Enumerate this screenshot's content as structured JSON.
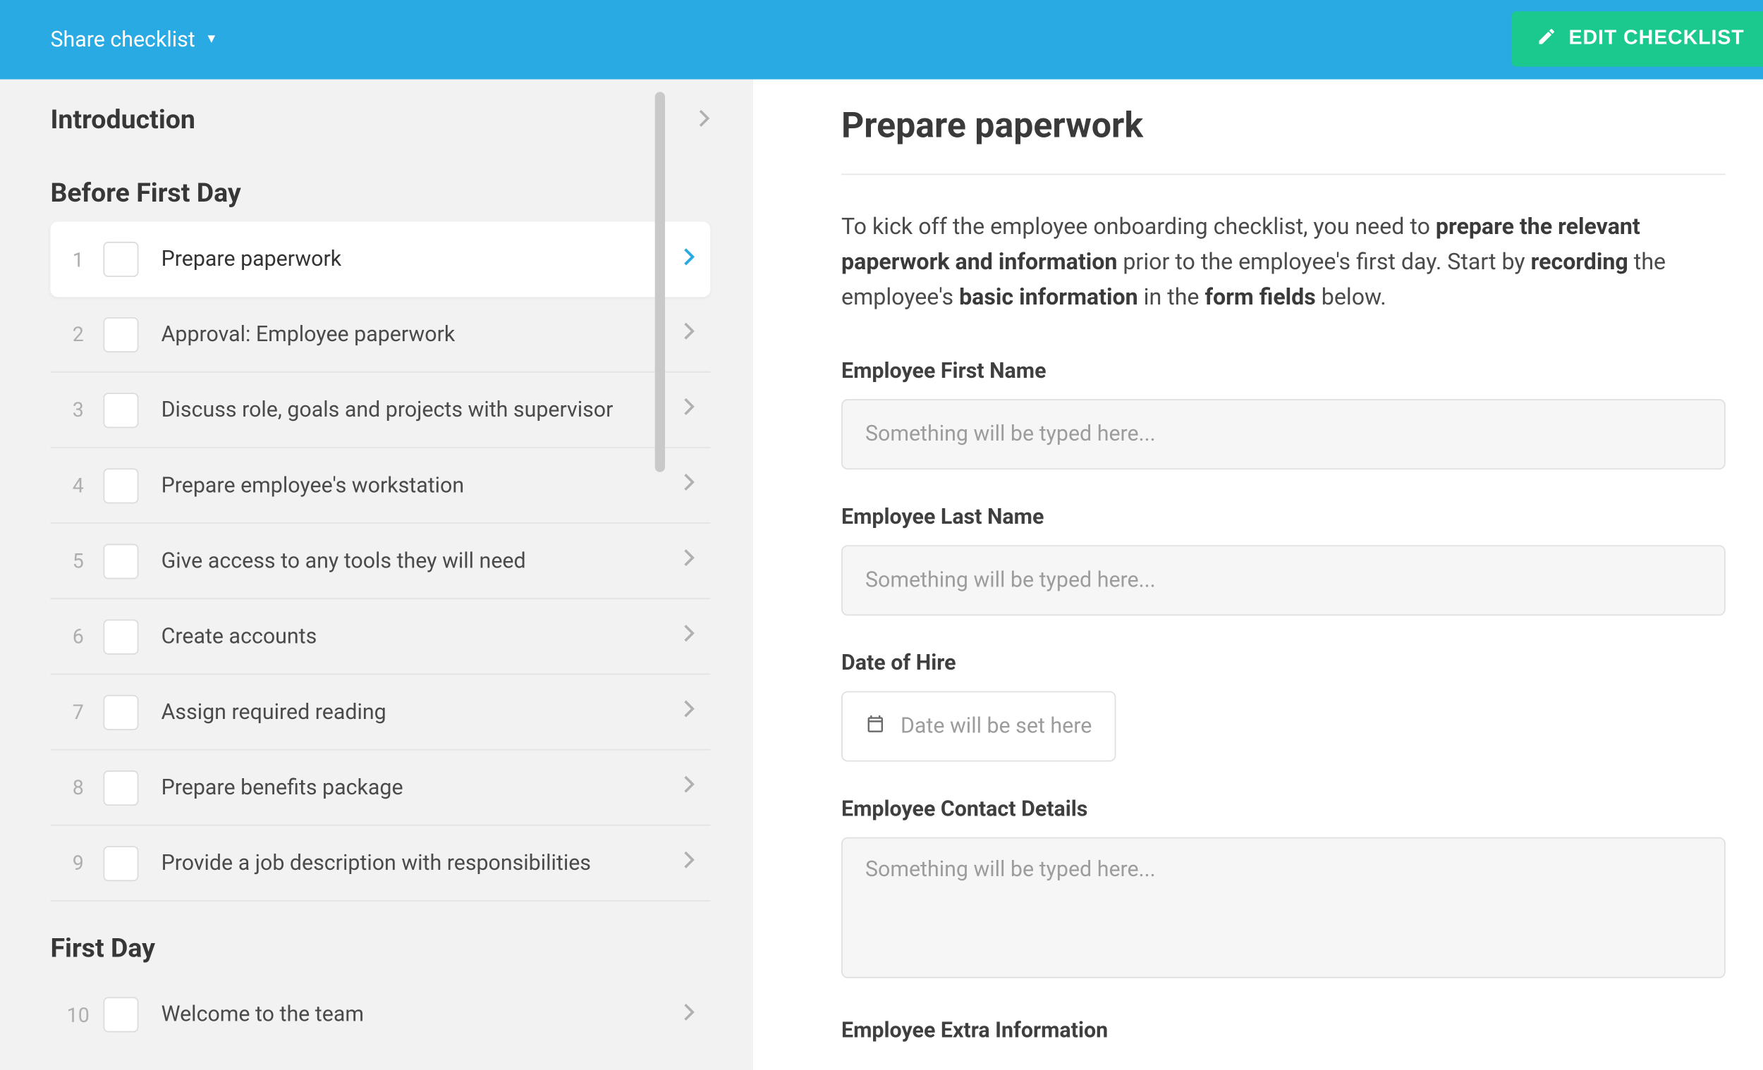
{
  "header": {
    "share_label": "Share checklist",
    "edit_label": "EDIT CHECKLIST"
  },
  "sidebar": {
    "sections": [
      {
        "title": "Introduction",
        "collapsible": true,
        "items": []
      },
      {
        "title": "Before First Day",
        "items": [
          {
            "num": "1",
            "label": "Prepare paperwork",
            "active": true
          },
          {
            "num": "2",
            "label": "Approval: Employee paperwork"
          },
          {
            "num": "3",
            "label": "Discuss role, goals and projects with supervisor"
          },
          {
            "num": "4",
            "label": "Prepare employee's workstation"
          },
          {
            "num": "5",
            "label": "Give access to any tools they will need"
          },
          {
            "num": "6",
            "label": "Create accounts"
          },
          {
            "num": "7",
            "label": "Assign required reading"
          },
          {
            "num": "8",
            "label": "Prepare benefits package"
          },
          {
            "num": "9",
            "label": "Provide a job description with responsibilities"
          }
        ]
      },
      {
        "title": "First Day",
        "items": [
          {
            "num": "10",
            "label": "Welcome to the team"
          }
        ]
      }
    ]
  },
  "content": {
    "title": "Prepare paperwork",
    "intro_parts": {
      "p1": "To kick off the employee onboarding checklist, you need to ",
      "b1": "prepare the relevant paperwork and information",
      "p2": " prior to the employee's first day. Start by ",
      "b2": "recording",
      "p3": " the employee's ",
      "b3": "basic information",
      "p4": " in the ",
      "b4": "form fields",
      "p5": " below."
    },
    "fields": {
      "first_name": {
        "label": "Employee First Name",
        "placeholder": "Something will be typed here..."
      },
      "last_name": {
        "label": "Employee Last Name",
        "placeholder": "Something will be typed here..."
      },
      "date_hire": {
        "label": "Date of Hire",
        "placeholder": "Date will be set here"
      },
      "contact": {
        "label": "Employee Contact Details",
        "placeholder": "Something will be typed here..."
      },
      "extra": {
        "label": "Employee Extra Information"
      }
    }
  }
}
